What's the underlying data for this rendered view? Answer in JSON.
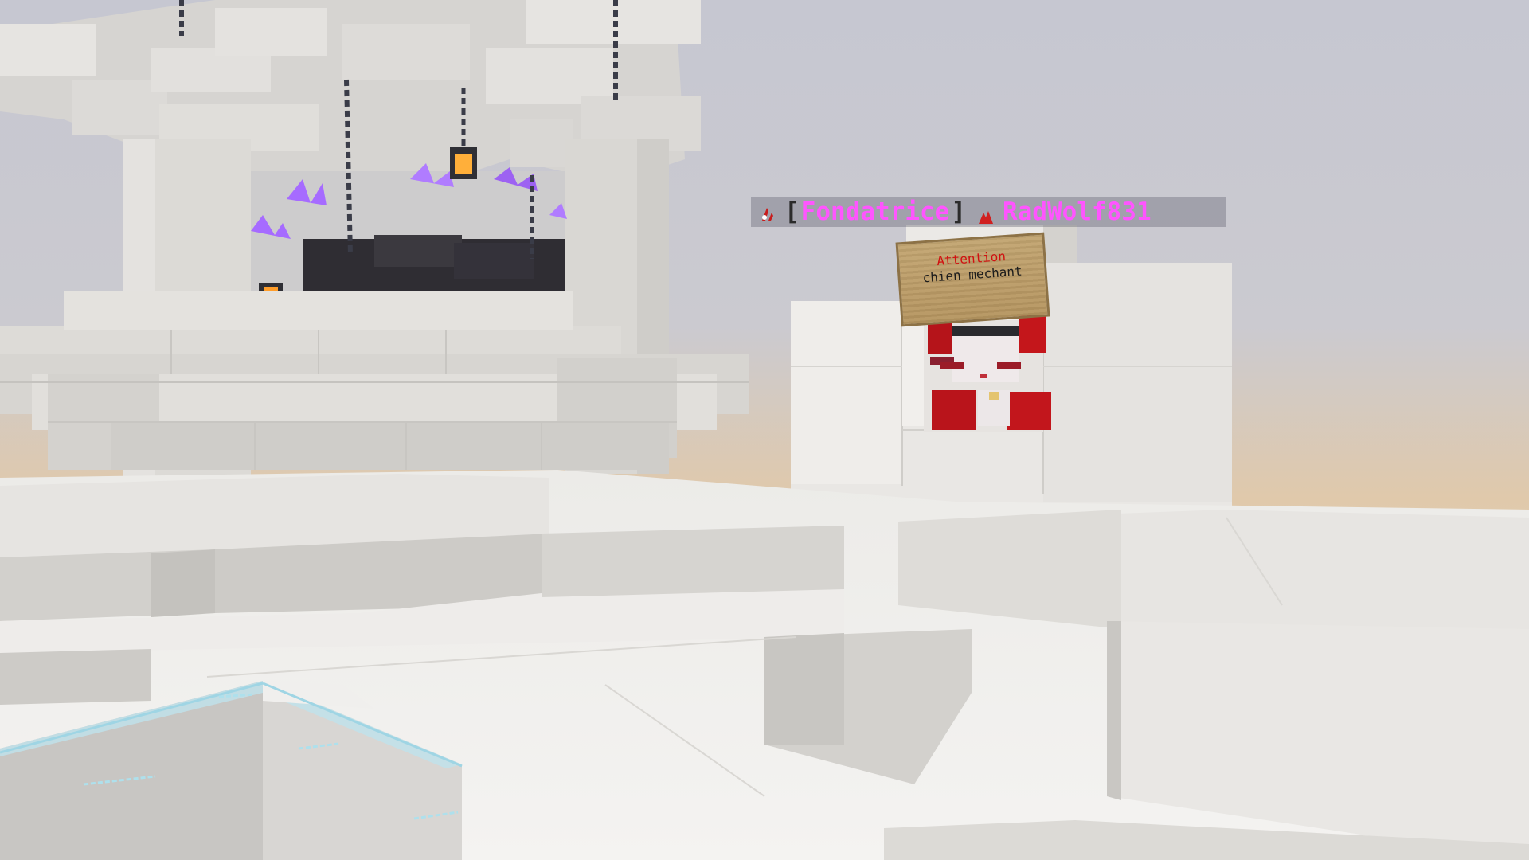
{
  "nametag": {
    "open_bracket": "[",
    "rank": "Fondatrice",
    "close_bracket": "]",
    "player": "RadWolf831",
    "rank_color": "#ff55ff",
    "prefix_icon": "claw-icon",
    "separator_icon": "wolf-icon"
  },
  "sign": {
    "line1": "Attention",
    "line2": "chien mechant",
    "line1_color": "#d11010"
  },
  "world": {
    "sky_colors": [
      "#c9cad3",
      "#e0c8a8"
    ],
    "block_color": "#e3e1de",
    "amethyst_color": "#a66bff"
  }
}
